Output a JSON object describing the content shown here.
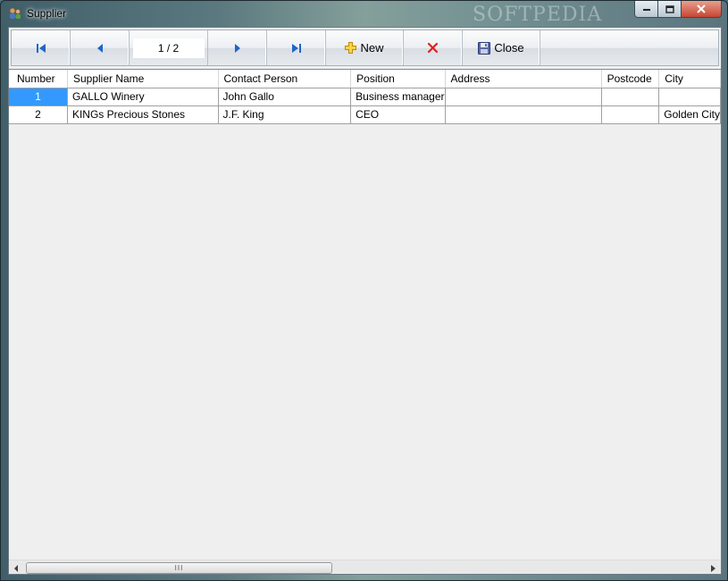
{
  "window": {
    "title": "Supplier",
    "watermark": "SOFTPEDIA"
  },
  "toolbar": {
    "page_indicator": "1 / 2",
    "new_label": "New",
    "close_label": "Close"
  },
  "grid": {
    "columns": [
      "Number",
      "Supplier Name",
      "Contact Person",
      "Position",
      "Address",
      "Postcode",
      "City"
    ],
    "rows": [
      [
        "1",
        "GALLO Winery",
        "John Gallo",
        "Business manager",
        "",
        "",
        ""
      ],
      [
        "2",
        "KINGs Precious Stones",
        "J.F. King",
        "CEO",
        "",
        "",
        "Golden City"
      ]
    ]
  },
  "scrollbar": {
    "thumb_grip": "III"
  },
  "colors": {
    "selection": "#3399ff",
    "new_icon": "#f0b400",
    "delete_icon": "#e0201b",
    "nav_arrow": "#1f66c8"
  }
}
